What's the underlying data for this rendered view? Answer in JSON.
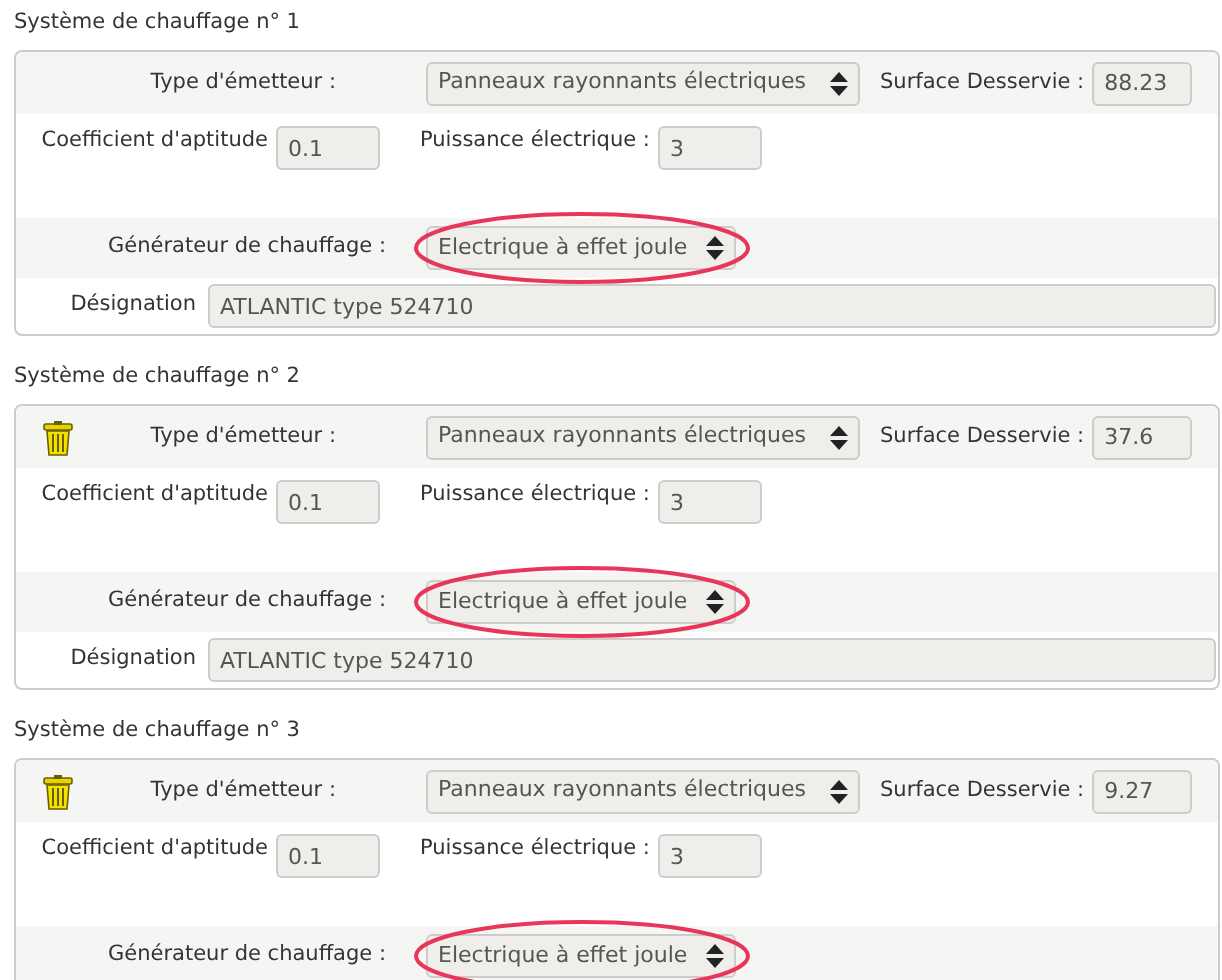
{
  "systems": [
    {
      "title": "Système de chauffage n° 1",
      "deletable": false,
      "emitter_label": "Type d'émetteur :",
      "emitter": "Panneaux rayonnants électriques",
      "surface_label": "Surface Desservie :",
      "surface": "88.23",
      "coef_label": "Coefficient d'aptitude",
      "coef": "0.1",
      "power_label": "Puissance électrique :",
      "power": "3",
      "generator_label": "Générateur de chauffage :",
      "generator": "Electrique à effet joule",
      "highlighted": true,
      "designation_label": "Désignation",
      "designation": "ATLANTIC type 524710"
    },
    {
      "title": "Système de chauffage n° 2",
      "deletable": true,
      "emitter_label": "Type d'émetteur :",
      "emitter": "Panneaux rayonnants électriques",
      "surface_label": "Surface Desservie :",
      "surface": "37.6",
      "coef_label": "Coefficient d'aptitude",
      "coef": "0.1",
      "power_label": "Puissance électrique :",
      "power": "3",
      "generator_label": "Générateur de chauffage :",
      "generator": "Electrique à effet joule",
      "highlighted": true,
      "designation_label": "Désignation",
      "designation": "ATLANTIC type 524710"
    },
    {
      "title": "Système de chauffage n° 3",
      "deletable": true,
      "emitter_label": "Type d'émetteur :",
      "emitter": "Panneaux rayonnants électriques",
      "surface_label": "Surface Desservie :",
      "surface": "9.27",
      "coef_label": "Coefficient d'aptitude",
      "coef": "0.1",
      "power_label": "Puissance électrique :",
      "power": "3",
      "generator_label": "Générateur de chauffage :",
      "generator": "Electrique à effet joule",
      "highlighted": true
    }
  ]
}
